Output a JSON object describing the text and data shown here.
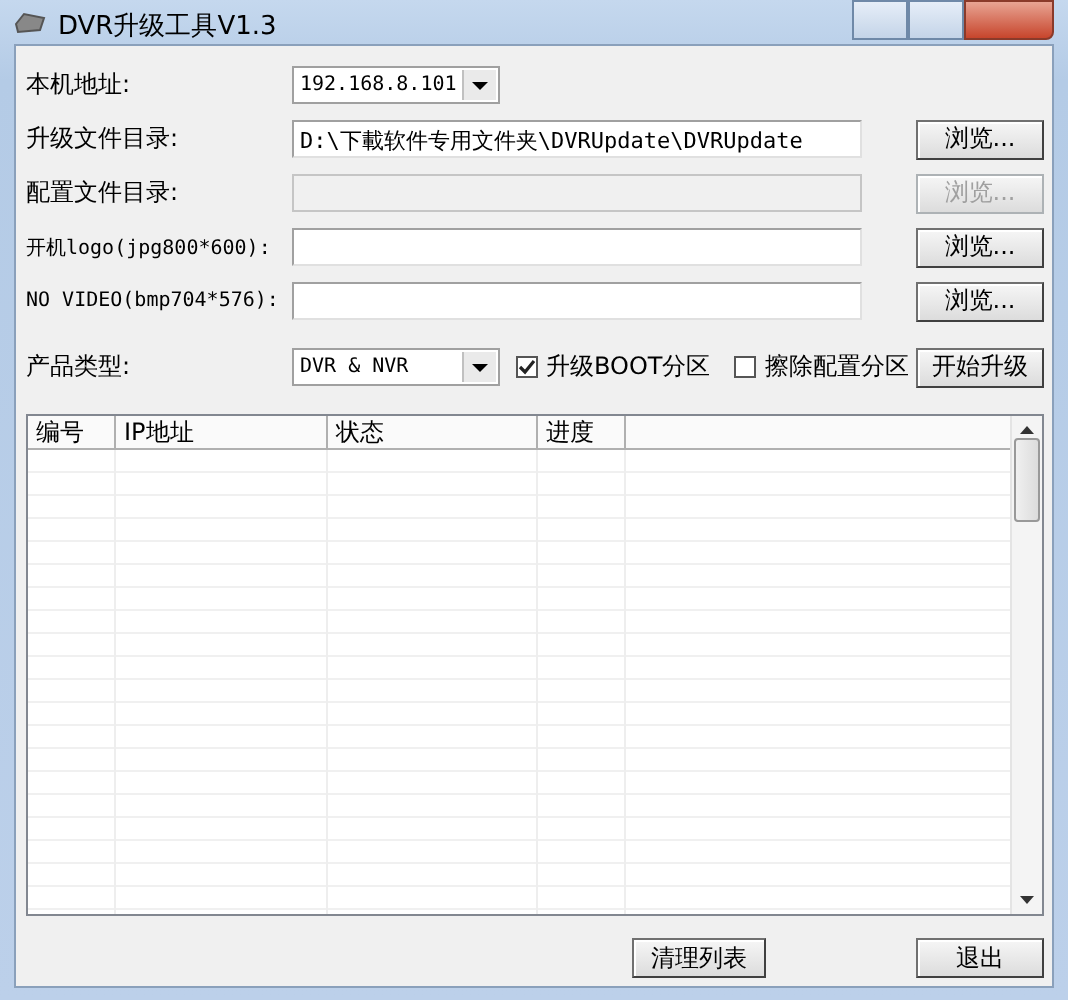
{
  "window": {
    "title": "DVR升级工具V1.3"
  },
  "fields": [
    {
      "kind": "select",
      "label": "本机地址:",
      "value": "192.168.8.101"
    },
    {
      "kind": "path",
      "label": "升级文件目录:",
      "value": "D:\\下載软件专用文件夹\\DVRUpdate\\DVRUpdate",
      "button": "浏览...",
      "disabled": false
    },
    {
      "kind": "path",
      "label": "配置文件目录:",
      "button": "浏览...",
      "disabled": true
    },
    {
      "kind": "path",
      "label": "开机logo(jpg800*600):",
      "button": "浏览...",
      "disabled": false
    },
    {
      "kind": "path",
      "label": "NO VIDEO(bmp704*576):",
      "button": "浏览...",
      "disabled": false
    }
  ],
  "product": {
    "label": "产品类型:",
    "value": "DVR & NVR",
    "options": [
      {
        "label": "升级BOOT分区",
        "checked": true
      },
      {
        "label": "擦除配置分区",
        "checked": false
      }
    ],
    "start_button": "开始升级"
  },
  "table": {
    "columns": [
      "编号",
      "IP地址",
      "状态",
      "进度"
    ]
  },
  "buttons": [
    "清理列表",
    "退出"
  ]
}
